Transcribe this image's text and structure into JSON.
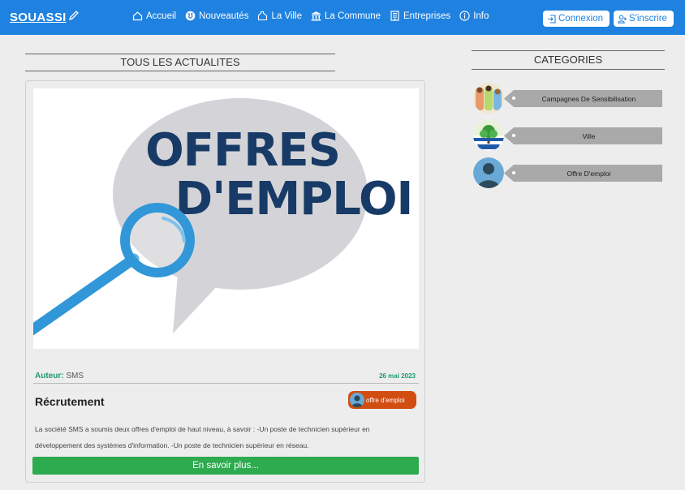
{
  "navbar": {
    "brand": "SOUASSI",
    "items": [
      {
        "label": "Accueil",
        "icon": "home-icon"
      },
      {
        "label": "Nouveautés",
        "icon": "globe-icon"
      },
      {
        "label": "La Ville",
        "icon": "city-icon"
      },
      {
        "label": "La Commune",
        "icon": "bank-icon"
      },
      {
        "label": "Entreprises",
        "icon": "building-icon"
      },
      {
        "label": "Info",
        "icon": "info-icon"
      }
    ],
    "login": "Connexion",
    "signup": "S'inscrire"
  },
  "main": {
    "section_title": "TOUS LES ACTUALITES",
    "post": {
      "image_text_line1": "OFFRES",
      "image_text_line2": "D'EMPLOI",
      "author_label": "Auteur:",
      "author": "SMS",
      "date": "26 mai 2023",
      "title": "Récrutement",
      "category_badge": "offre d'emploi",
      "text": "La société SMS a soumis deux offres d'emploi de haut niveau, à savoir : -Un poste de technicien supérieur en développement des systèmes d'information. -Un poste de technicien supérieur en réseau.",
      "read_more": "En savoir plus..."
    }
  },
  "sidebar": {
    "title": "CATEGORIES",
    "categories": [
      {
        "label": "Campagnes De Sensibilisation"
      },
      {
        "label": "Ville"
      },
      {
        "label": "Offre D'emploi"
      }
    ]
  },
  "colors": {
    "navbar": "#1f82e0",
    "button_green": "#2eab4f",
    "badge_orange": "#d24d11",
    "accent_teal": "#1a9a74",
    "tag_gray": "#a9a9a9",
    "image_navy": "#173a66",
    "image_blue": "#3197d8"
  }
}
